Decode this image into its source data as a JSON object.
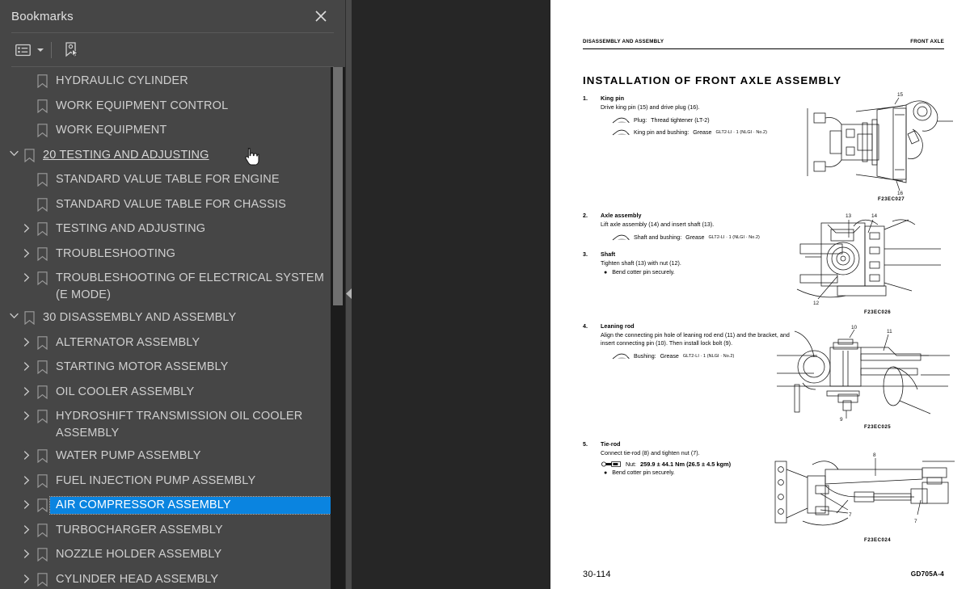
{
  "panel": {
    "title": "Bookmarks",
    "close_icon": "close-icon",
    "toolbar": {
      "options_icon": "list-options-icon",
      "caret_icon": "chevron-down-icon",
      "new_bookmark_icon": "new-bookmark-icon"
    }
  },
  "bookmarks": [
    {
      "label": "HYDRAULIC CYLINDER",
      "depth": 2,
      "twisty": "none",
      "state": "normal"
    },
    {
      "label": "WORK EQUIPMENT CONTROL",
      "depth": 2,
      "twisty": "none",
      "state": "normal"
    },
    {
      "label": "WORK EQUIPMENT",
      "depth": 2,
      "twisty": "none",
      "state": "normal"
    },
    {
      "label": "20 TESTING AND ADJUSTING",
      "depth": 1,
      "twisty": "expanded",
      "state": "hovered"
    },
    {
      "label": "STANDARD VALUE TABLE FOR ENGINE",
      "depth": 2,
      "twisty": "none",
      "state": "normal"
    },
    {
      "label": "STANDARD VALUE TABLE FOR CHASSIS",
      "depth": 2,
      "twisty": "none",
      "state": "normal"
    },
    {
      "label": "TESTING AND ADJUSTING",
      "depth": 2,
      "twisty": "collapsed",
      "state": "normal"
    },
    {
      "label": "TROUBLESHOOTING",
      "depth": 2,
      "twisty": "collapsed",
      "state": "normal"
    },
    {
      "label": "TROUBLESHOOTING OF ELECTRICAL SYSTEM (E MODE)",
      "depth": 2,
      "twisty": "collapsed",
      "state": "normal"
    },
    {
      "label": "30 DISASSEMBLY AND ASSEMBLY",
      "depth": 1,
      "twisty": "expanded",
      "state": "normal"
    },
    {
      "label": "ALTERNATOR ASSEMBLY",
      "depth": 2,
      "twisty": "collapsed",
      "state": "normal"
    },
    {
      "label": "STARTING MOTOR ASSEMBLY",
      "depth": 2,
      "twisty": "collapsed",
      "state": "normal"
    },
    {
      "label": "OIL COOLER ASSEMBLY",
      "depth": 2,
      "twisty": "collapsed",
      "state": "normal"
    },
    {
      "label": "HYDROSHIFT TRANSMISSION OIL COOLER ASSEMBLY",
      "depth": 2,
      "twisty": "collapsed",
      "state": "normal"
    },
    {
      "label": "WATER PUMP ASSEMBLY",
      "depth": 2,
      "twisty": "collapsed",
      "state": "normal"
    },
    {
      "label": "FUEL INJECTION PUMP ASSEMBLY",
      "depth": 2,
      "twisty": "collapsed",
      "state": "normal"
    },
    {
      "label": "AIR COMPRESSOR ASSEMBLY",
      "depth": 2,
      "twisty": "collapsed",
      "state": "selected"
    },
    {
      "label": "TURBOCHARGER ASSEMBLY",
      "depth": 2,
      "twisty": "collapsed",
      "state": "normal"
    },
    {
      "label": "NOZZLE HOLDER ASSEMBLY",
      "depth": 2,
      "twisty": "collapsed",
      "state": "normal"
    },
    {
      "label": "CYLINDER HEAD ASSEMBLY",
      "depth": 2,
      "twisty": "collapsed",
      "state": "normal"
    }
  ],
  "colors": {
    "panel_bg": "#464646",
    "selection_blue": "#0a84e0",
    "text": "#cfcfcf",
    "viewer_bg": "#262626",
    "scrollbar_track": "#1c1c1c",
    "scrollbar_thumb": "#707070"
  },
  "gutter": {
    "collapse_icon": "collapse-left-arrow-icon"
  },
  "document": {
    "header_left": "DISASSEMBLY AND ASSEMBLY",
    "header_right": "FRONT AXLE",
    "title": "INSTALLATION OF FRONT AXLE ASSEMBLY",
    "footer_page": "30-114",
    "footer_model": "GD705A-4",
    "steps": [
      {
        "num": "1.",
        "head": "King pin",
        "text": "Drive king pin (15) and drive plug (16).",
        "specs": [
          {
            "icon": "grease-symbol-icon",
            "label": "Plug:",
            "value": "Thread tightener (LT-2)",
            "sub": ""
          },
          {
            "icon": "grease-symbol-icon",
            "label": "King pin and bushing:",
            "value": "Grease",
            "sub": "GLT2-LI · 1 (NLGI · No.2)"
          }
        ],
        "bullets": []
      },
      {
        "num": "2.",
        "head": "Axle assembly",
        "text": "Lift axle assembly (14) and insert shaft (13).",
        "specs": [
          {
            "icon": "grease-symbol-icon",
            "label": "Shaft and bushing:",
            "value": "Grease",
            "sub": "GLT2-LI · 1 (NLGI · No.2)"
          }
        ],
        "bullets": []
      },
      {
        "num": "3.",
        "head": "Shaft",
        "text": "Tighten shaft (13) with nut (12).",
        "specs": [],
        "bullets": [
          "Bend cotter pin securely."
        ]
      },
      {
        "num": "4.",
        "head": "Leaning rod",
        "text": "Align the connecting pin hole of leaning rod end (11) and the bracket, and insert connecting pin (10). Then install lock bolt (9).",
        "specs": [
          {
            "icon": "grease-symbol-icon",
            "label": "Bushing:",
            "value": "Grease",
            "sub": "GLT2-LI · 1 (NLGI · No.2)"
          }
        ],
        "bullets": []
      },
      {
        "num": "5.",
        "head": "Tie-rod",
        "text": "Connect tie-rod (8) and tighten nut (7).",
        "specs": [
          {
            "icon": "torque-wrench-icon",
            "label": "Nut:",
            "value": "259.9 ± 44.1 Nm (26.5 ± 4.5 kgm)",
            "sub": "",
            "bold": true
          }
        ],
        "bullets": [
          "Bend cotter pin securely."
        ]
      }
    ],
    "figures": [
      {
        "ref": "F23EC027",
        "callouts": [
          "15",
          "16"
        ]
      },
      {
        "ref": "F23EC026",
        "callouts": [
          "13",
          "14",
          "12"
        ]
      },
      {
        "ref": "F23EC025",
        "callouts": [
          "10",
          "11",
          "9"
        ]
      },
      {
        "ref": "F23EC024",
        "callouts": [
          "8",
          "7",
          "7"
        ]
      }
    ]
  }
}
